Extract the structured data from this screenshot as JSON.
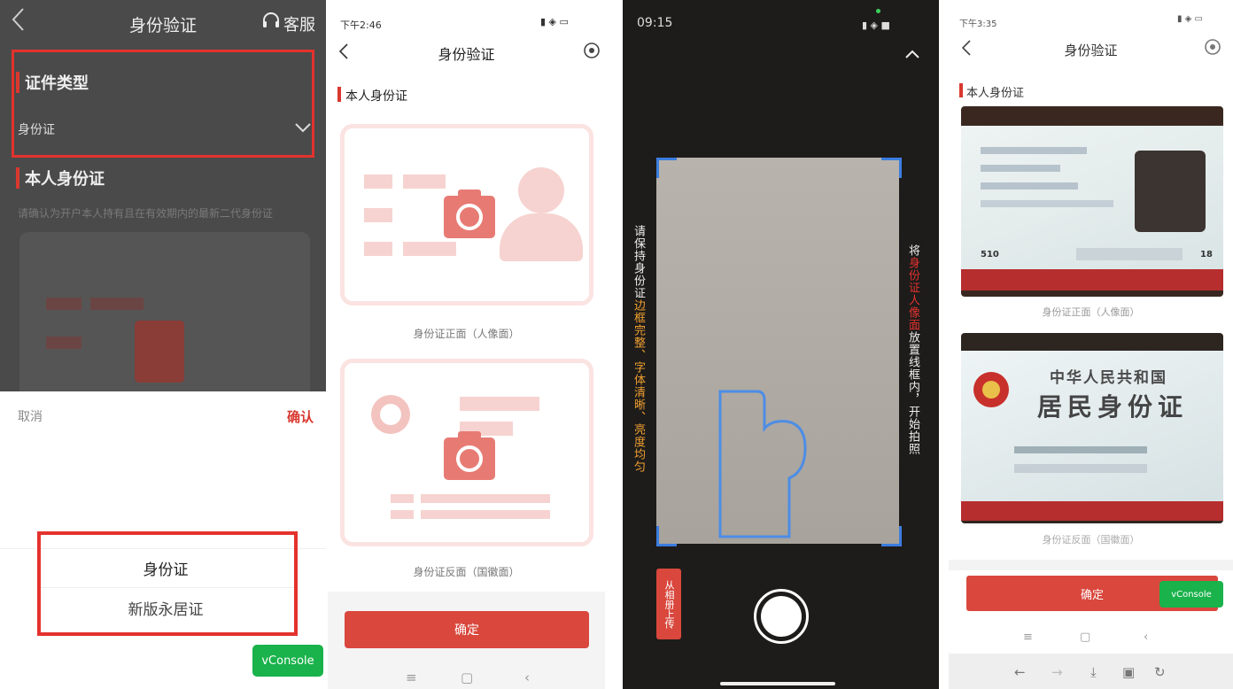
{
  "panel1": {
    "title": "身份验证",
    "service_label": "客服",
    "section1_title": "证件类型",
    "doc_type_value": "身份证",
    "section2_title": "本人身份证",
    "hint": "请确认为开户本人持有且在有效期内的最新二代身份证",
    "cancel_label": "取消",
    "confirm_label": "确认",
    "options": [
      "身份证",
      "新版永居证"
    ],
    "vconsole": "vConsole"
  },
  "panel2": {
    "status_time": "下午2:46",
    "title": "身份验证",
    "section_title": "本人身份证",
    "front_label": "身份证正面（人像面）",
    "back_label": "身份证反面（国徽面）",
    "confirm_button": "确定"
  },
  "panel3": {
    "status_time": "09:15",
    "left_text_white": "请保持身份证",
    "left_text_orange": "边框完整、字体清晰、亮度均匀",
    "right_text_a": "将",
    "right_text_red": "身份证人像面",
    "right_text_b": "放置线框内，开始拍照",
    "album_button": "从相册上传"
  },
  "panel4": {
    "status_time": "下午3:35",
    "title": "身份验证",
    "section_title": "本人身份证",
    "front_card_id": "510",
    "front_card_id_tail": "18",
    "front_label": "身份证正面（人像面）",
    "back_card_line1": "中华人民共和国",
    "back_card_line2": "居民身份证",
    "back_label": "身份证反面（国徽面）",
    "confirm_button": "确定",
    "vconsole": "vConsole"
  },
  "icons": {
    "back": "chevron-left-icon",
    "service": "headset-icon",
    "dropdown": "chevron-down-icon",
    "camera": "camera-icon",
    "shutter": "shutter-icon"
  },
  "colors": {
    "accent": "#d9382f",
    "vconsole": "#1ab24b",
    "orange": "#f0a030",
    "guide_blue": "#3c7de0"
  }
}
